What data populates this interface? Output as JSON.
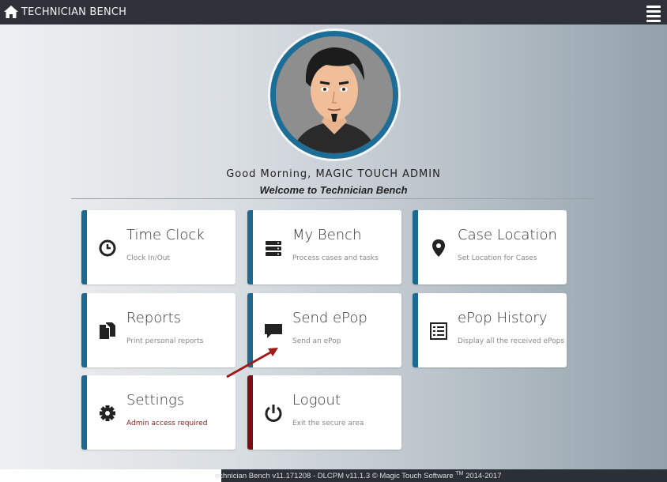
{
  "header": {
    "title": "TECHNICIAN BENCH"
  },
  "user": {
    "greeting": "Good Morning, MAGIC TOUCH ADMIN",
    "welcome": "Welcome to Technician Bench"
  },
  "tiles": [
    {
      "title": "Time Clock",
      "subtitle": "Clock In/Out",
      "icon": "clock-icon"
    },
    {
      "title": "My Bench",
      "subtitle": "Process cases and tasks",
      "icon": "server-stack-icon"
    },
    {
      "title": "Case Location",
      "subtitle": "Set Location for Cases",
      "icon": "map-pin-icon"
    },
    {
      "title": "Reports",
      "subtitle": "Print personal reports",
      "icon": "files-icon"
    },
    {
      "title": "Send ePop",
      "subtitle": "Send an ePop",
      "icon": "chat-bubble-icon"
    },
    {
      "title": "ePop History",
      "subtitle": "Display all the received ePops",
      "icon": "list-icon"
    },
    {
      "title": "Settings",
      "subtitle": "Admin access required",
      "icon": "gear-icon"
    },
    {
      "title": "Logout",
      "subtitle": "Exit the secure area",
      "icon": "power-icon"
    }
  ],
  "footer": {
    "text": "echnician Bench v11.171208 - DLCPM v11.1.3 © Magic Touch Software",
    "tm": "TM",
    "years": "2014-2017"
  },
  "colors": {
    "accent": "#1c6a91",
    "logout": "#7c0f16",
    "topbar": "#2e3138"
  }
}
